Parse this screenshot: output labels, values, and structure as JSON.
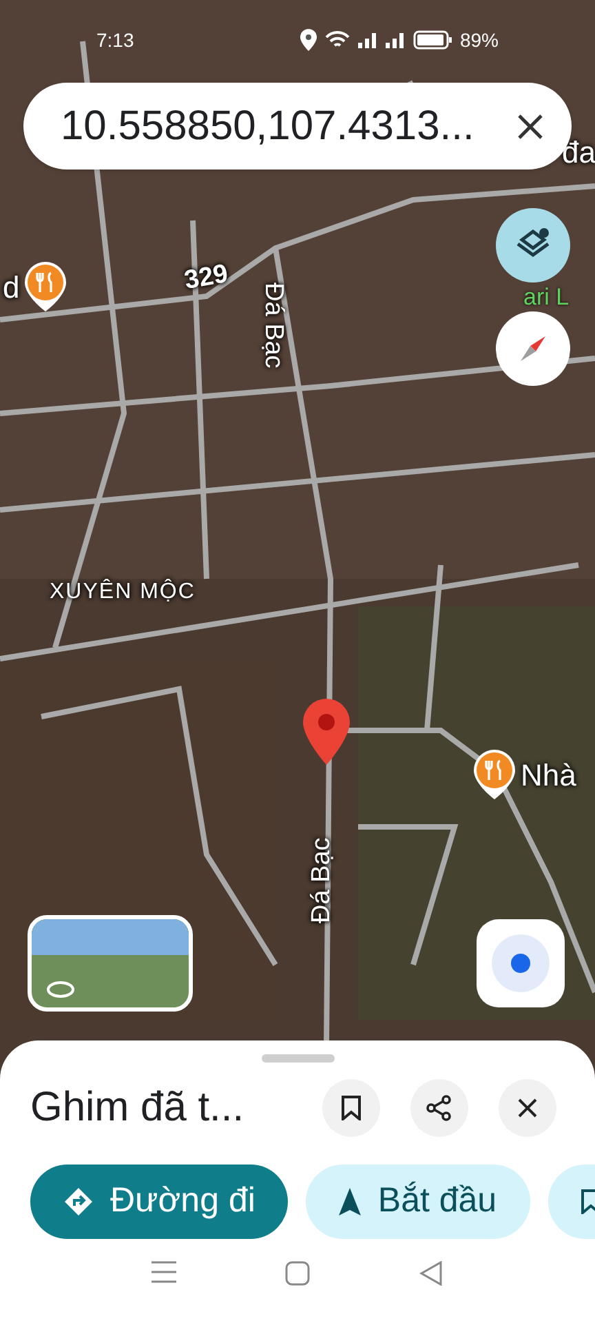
{
  "status_bar": {
    "time": "7:13",
    "battery": "89%"
  },
  "search": {
    "value": "10.558850,107.4313..."
  },
  "map_texts": [
    {
      "kind": "partial",
      "text": "đa"
    },
    {
      "kind": "restaurant",
      "text": "d"
    },
    {
      "kind": "road",
      "text": "329"
    },
    {
      "kind": "park",
      "text": "ari L"
    },
    {
      "kind": "road_vertical",
      "text": "Đá Bạc"
    },
    {
      "kind": "area",
      "text": "XUYÊN MỘC"
    },
    {
      "kind": "restaurant",
      "text": "Nhà"
    },
    {
      "kind": "road_vertical",
      "text": "Đá Bạc"
    }
  ],
  "sheet": {
    "title": "Ghim đã t...",
    "chips": [
      {
        "label": "Đường đi",
        "selected": true
      },
      {
        "label": "Bắt đầu",
        "selected": false
      },
      {
        "selected": false
      }
    ]
  }
}
